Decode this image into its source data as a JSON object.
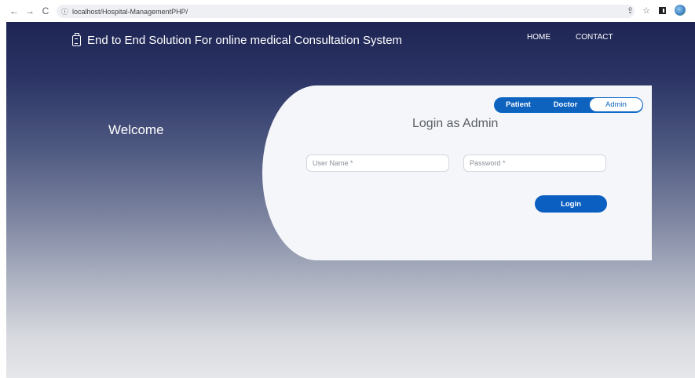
{
  "browser": {
    "url": "localhost/Hospital-ManagementPHP/",
    "icons": [
      "back-icon",
      "forward-icon",
      "reload-icon",
      "info-icon",
      "share-icon",
      "star-icon",
      "sidepanel-icon",
      "profile-icon"
    ]
  },
  "header": {
    "brand": "End to End Solution For online medical Consultation System",
    "nav": [
      "HOME",
      "CONTACT"
    ]
  },
  "hero": {
    "welcome": "Welcome"
  },
  "login": {
    "tabs": [
      "Patient",
      "Doctor",
      "Admin"
    ],
    "active_tab": "Admin",
    "title": "Login as Admin",
    "username_placeholder": "User Name *",
    "password_placeholder": "Password *",
    "button": "Login"
  },
  "colors": {
    "accent": "#0a5fc0",
    "header_dark": "#1e2554",
    "card": "#f5f6f9"
  }
}
